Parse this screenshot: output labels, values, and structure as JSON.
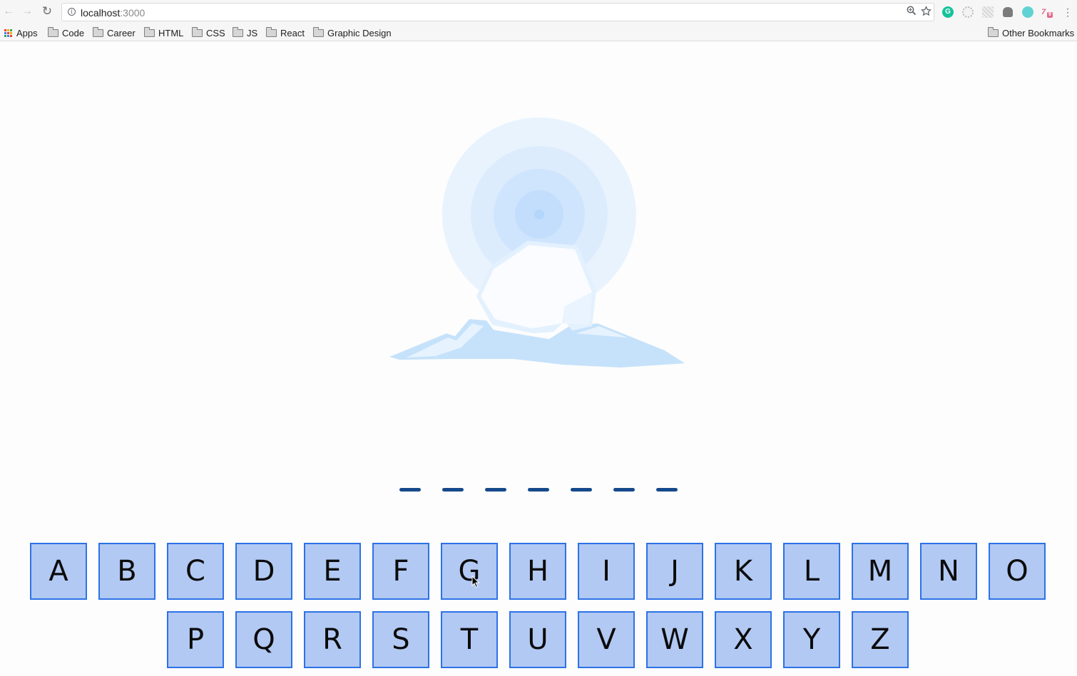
{
  "browser": {
    "url_host": "localhost",
    "url_port": ":3000",
    "nav": {
      "back_icon": "←",
      "forward_icon": "→",
      "reload_icon": "↻"
    },
    "extensions": {
      "grammarly_letter": "G",
      "badge_letters": "7",
      "badge_count": "9"
    },
    "bookmarks": {
      "apps_label": "Apps",
      "folders": [
        "Code",
        "Career",
        "HTML",
        "CSS",
        "JS",
        "React",
        "Graphic Design"
      ],
      "other_label": "Other Bookmarks"
    }
  },
  "game": {
    "word_blank_count": 7,
    "colors": {
      "key_fill": "#b2c9f3",
      "key_border": "#2d72e6",
      "blank": "#16498b",
      "glow": "#d2e8ff",
      "ice": "#c9e4fb"
    },
    "keyboard_row1": [
      "A",
      "B",
      "C",
      "D",
      "E",
      "F",
      "G",
      "H",
      "I",
      "J",
      "K",
      "L",
      "M",
      "N",
      "O"
    ],
    "keyboard_row2": [
      "P",
      "Q",
      "R",
      "S",
      "T",
      "U",
      "V",
      "W",
      "X",
      "Y",
      "Z"
    ]
  }
}
